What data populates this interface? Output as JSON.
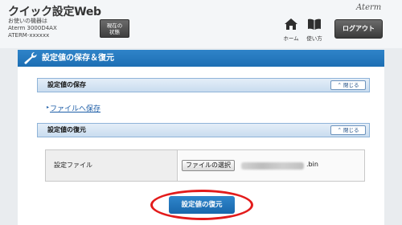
{
  "header": {
    "app_title": "クイック設定Web",
    "device_lines": [
      "お使いの機器は",
      "Aterm 3000D4AX",
      "ATERM-xxxxxx"
    ],
    "status_button": [
      "現在の",
      "状態"
    ],
    "brand": "Aterm",
    "nav": [
      {
        "label": "ホーム",
        "icon": "home-icon"
      },
      {
        "label": "使い方",
        "icon": "book-icon"
      }
    ],
    "logout_label": "ログアウト"
  },
  "main": {
    "title": "設定値の保存＆復元",
    "title_icon": "wrench-icon",
    "save_section": {
      "title": "設定値の保存",
      "close_label": "閉じる",
      "link_label": "ファイルへ保存"
    },
    "restore_section": {
      "title": "設定値の復元",
      "close_label": "閉じる",
      "file_label": "設定ファイル",
      "choose_button": "ファイルの選択",
      "file_name_suffix": ".bin"
    },
    "restore_button": "設定値の復元"
  },
  "colors": {
    "accent": "#1f74b9",
    "highlight": "#e31b1b",
    "link": "#1f5fa8"
  }
}
